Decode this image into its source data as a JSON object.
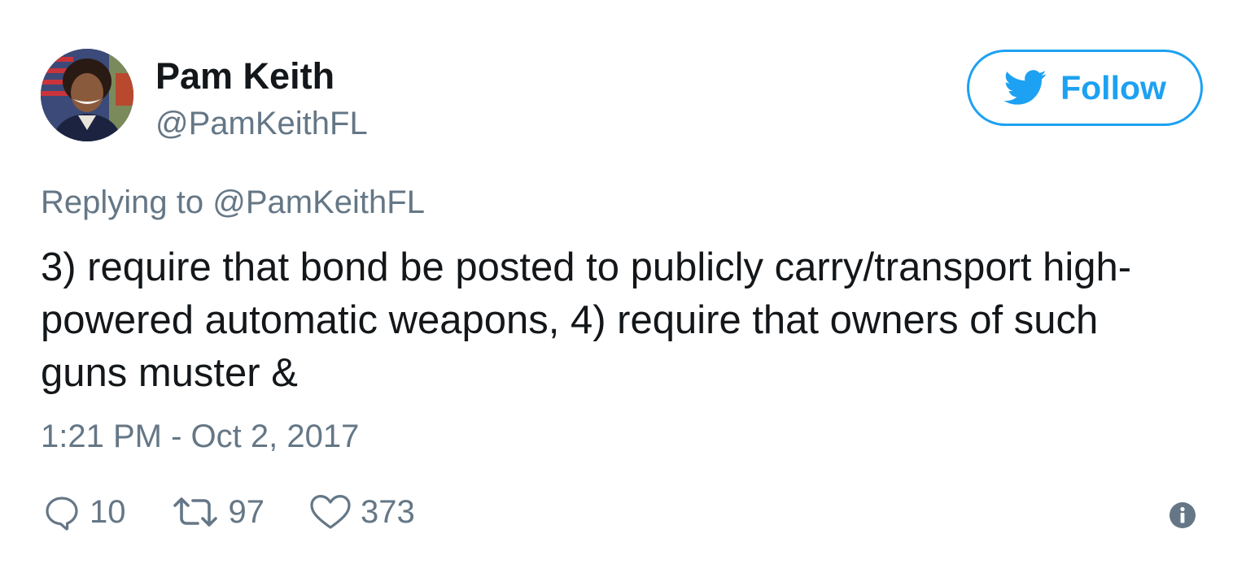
{
  "author": {
    "display_name": "Pam Keith",
    "handle": "@PamKeithFL",
    "avatar_icon": "profile-photo"
  },
  "follow_button": {
    "label": "Follow",
    "icon": "twitter-bird-icon",
    "color": "#1da1f2"
  },
  "reply": {
    "prefix": "Replying to",
    "mention": "@PamKeithFL"
  },
  "tweet": {
    "lines": [
      "3) require that bond be posted to publicly carry/transport high-",
      "powered automatic weapons, 4) require that owners of such",
      "guns muster &"
    ],
    "timestamp": "1:21 PM - Oct 2, 2017"
  },
  "actions": {
    "replies": {
      "icon": "reply-icon",
      "count": "10"
    },
    "retweets": {
      "icon": "retweet-icon",
      "count": "97"
    },
    "likes": {
      "icon": "heart-icon",
      "count": "373"
    },
    "info": {
      "icon": "info-icon"
    }
  },
  "colors": {
    "primary_text": "#14171a",
    "secondary_text": "#657786",
    "accent": "#1da1f2"
  }
}
